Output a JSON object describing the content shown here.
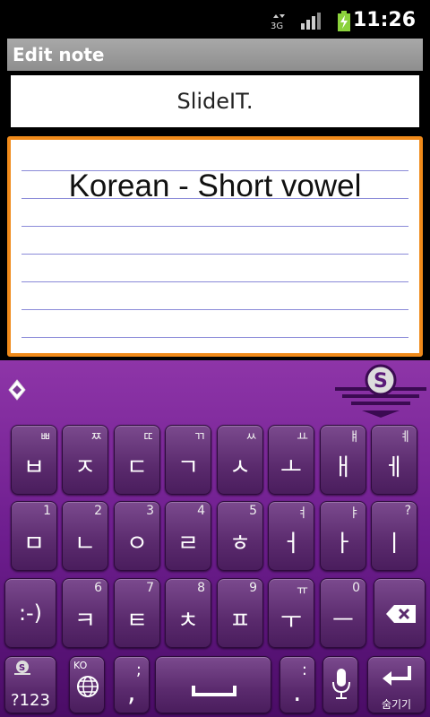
{
  "status": {
    "time": "11:26"
  },
  "title": "Edit note",
  "note_title": "SlideIT.",
  "note_text": "Korean - Short vowel",
  "keyboard": {
    "row1": [
      {
        "main": "ㅂ",
        "sub": "ㅃ"
      },
      {
        "main": "ㅈ",
        "sub": "ㅉ"
      },
      {
        "main": "ㄷ",
        "sub": "ㄸ"
      },
      {
        "main": "ㄱ",
        "sub": "ㄲ"
      },
      {
        "main": "ㅅ",
        "sub": "ㅆ"
      },
      {
        "main": "ㅗ",
        "sub": "ㅛ"
      },
      {
        "main": "ㅐ",
        "sub": "ㅒ"
      },
      {
        "main": "ㅔ",
        "sub": "ㅖ"
      }
    ],
    "row2": [
      {
        "main": "ㅁ",
        "sub": "1"
      },
      {
        "main": "ㄴ",
        "sub": "2"
      },
      {
        "main": "ㅇ",
        "sub": "3"
      },
      {
        "main": "ㄹ",
        "sub": "4"
      },
      {
        "main": "ㅎ",
        "sub": "5"
      },
      {
        "main": "ㅓ",
        "sub": "ㅕ"
      },
      {
        "main": "ㅏ",
        "sub": "ㅑ"
      },
      {
        "main": "ㅣ",
        "sub": "?"
      }
    ],
    "row3_smiley": ":-)",
    "row3": [
      {
        "main": "ㅋ",
        "sub": "6"
      },
      {
        "main": "ㅌ",
        "sub": "7"
      },
      {
        "main": "ㅊ",
        "sub": "8"
      },
      {
        "main": "ㅍ",
        "sub": "9"
      },
      {
        "main": "ㅜ",
        "sub": "ㅠ"
      },
      {
        "main": "ㅡ",
        "sub": "0"
      }
    ],
    "symbols_label": "?123",
    "lang_label": "KO",
    "punct_main": ",",
    "punct_sub": ";",
    "period_main": ".",
    "period_sub": ":",
    "enter_label": "숨기기"
  },
  "colors": {
    "accent_border": "#f08a1a",
    "keyboard_bg": "#6d1d8e",
    "rule_line": "#8a8ad8"
  }
}
